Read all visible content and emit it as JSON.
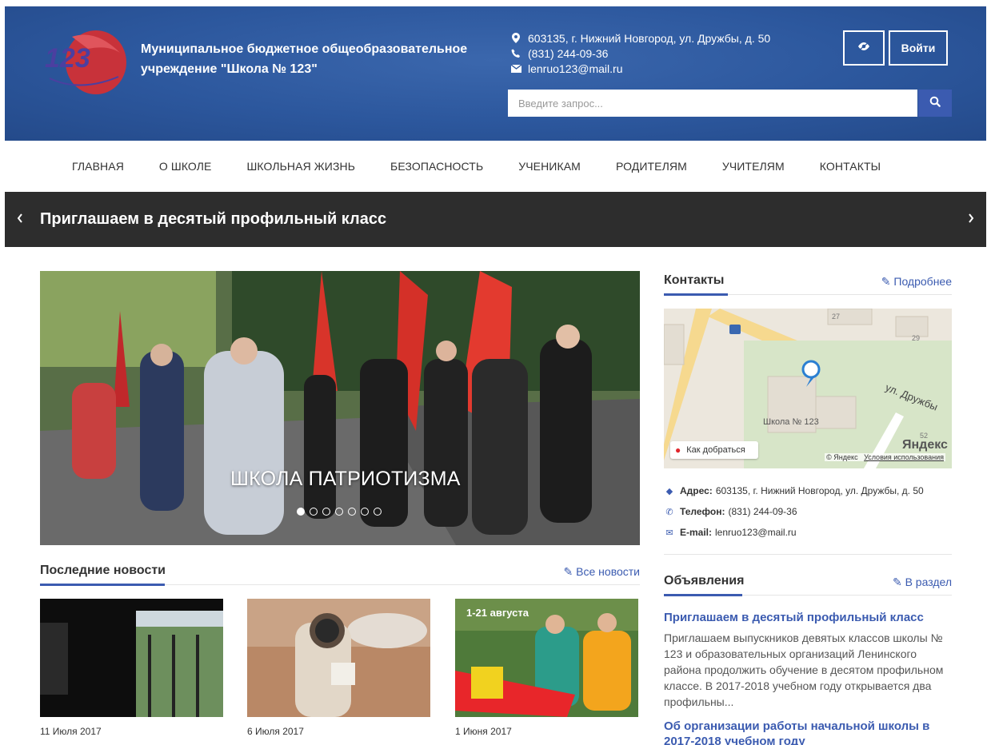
{
  "header": {
    "school_name": "Муниципальное бюджетное общеобразовательное учреждение \"Школа № 123\"",
    "address": "603135, г. Нижний Новгород, ул. Дружбы, д. 50",
    "phone": "(831) 244-09-36",
    "email": "lenruo123@mail.ru",
    "login_label": "Войти",
    "search_placeholder": "Введите запрос...",
    "logo_text": "123"
  },
  "nav": {
    "items": [
      "Главная",
      "О школе",
      "Школьная жизнь",
      "Безопасность",
      "Ученикам",
      "Родителям",
      "Учителям",
      "Контакты"
    ]
  },
  "ticker": {
    "title": "Приглашаем в десятый профильный класс"
  },
  "slider": {
    "caption": "ШКОЛА ПАТРИОТИЗМА",
    "total_slides": 7,
    "active_slide": 1
  },
  "news": {
    "heading": "Последние новости",
    "all_link": "Все новости",
    "items": [
      {
        "date": "11 Июля 2017",
        "title": ""
      },
      {
        "date": "6 Июля 2017",
        "title": ""
      },
      {
        "date": "1 Июня 2017",
        "title": "",
        "thumb_text": "1-21 августа"
      }
    ]
  },
  "contacts": {
    "heading": "Контакты",
    "more_link": "Подробнее",
    "address_label": "Адрес:",
    "address": "603135, г. Нижний Новгород, ул. Дружбы, д. 50",
    "phone_label": "Телефон:",
    "phone": "(831) 244-09-36",
    "email_label": "E-mail:",
    "email": "lenruo123@mail.ru",
    "map": {
      "street": "ул. Дружбы",
      "school_label": "Школа № 123",
      "route_button": "Как добраться",
      "brand": "Яндекс",
      "copyright": "© Яндекс",
      "terms_link": "Условия использования",
      "house_numbers": [
        "27",
        "29",
        "52"
      ]
    }
  },
  "announcements": {
    "heading": "Объявления",
    "section_link": "В раздел",
    "items": [
      {
        "title": "Приглашаем в десятый профильный класс",
        "text": "Приглашаем выпускников девятых классов школы № 123 и образовательных организаций Ленинского района продолжить обучение в десятом профильном классе. В 2017-2018 учебном году открывается два профильны..."
      },
      {
        "title": "Об организации работы начальной школы в 2017-2018 учебном году",
        "text": ""
      }
    ]
  },
  "colors": {
    "header_blue": "#2c579d",
    "accent": "#3b5bb0",
    "ticker_bg": "#2d2d2d"
  }
}
